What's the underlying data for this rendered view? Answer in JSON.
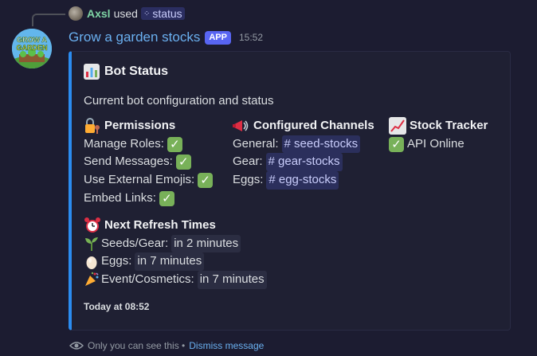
{
  "reply": {
    "username": "Axsl",
    "used_text": "used",
    "command": "status"
  },
  "message": {
    "bot_name": "Grow a garden stocks",
    "badge": "APP",
    "timestamp": "15:52",
    "avatar_text": "GROW A GARDEN"
  },
  "embed": {
    "accent_color": "#2b8cf0",
    "title": "Bot Status",
    "description": "Current bot configuration and status",
    "permissions": {
      "name": "Permissions",
      "items": [
        {
          "label": "Manage Roles:",
          "status": "✓"
        },
        {
          "label": "Send Messages:",
          "status": "✓"
        },
        {
          "label": "Use External Emojis:",
          "status": "✓"
        },
        {
          "label": "Embed Links:",
          "status": "✓"
        }
      ]
    },
    "channels": {
      "name": "Configured Channels",
      "items": [
        {
          "label": "General:",
          "channel": "# seed-stocks"
        },
        {
          "label": "Gear:",
          "channel": "# gear-stocks"
        },
        {
          "label": "Eggs:",
          "channel": "# egg-stocks"
        }
      ]
    },
    "stock_tracker": {
      "name": "Stock Tracker",
      "status": "✓",
      "text": "API Online"
    },
    "refresh": {
      "name": "Next Refresh Times",
      "items": [
        {
          "label": "Seeds/Gear:",
          "value": "in 2 minutes",
          "icon": "seedling-icon"
        },
        {
          "label": "Eggs:",
          "value": "in 7 minutes",
          "icon": "egg-icon"
        },
        {
          "label": "Event/Cosmetics:",
          "value": "in 7 minutes",
          "icon": "party-popper-icon"
        }
      ]
    },
    "footer": "Today at 08:52"
  },
  "ephemeral": {
    "text": "Only you can see this •",
    "dismiss": "Dismiss message"
  }
}
